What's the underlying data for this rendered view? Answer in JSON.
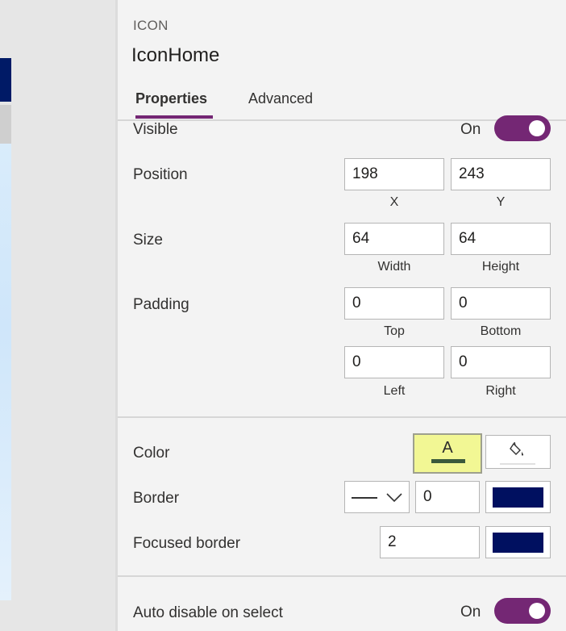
{
  "control": {
    "type": "ICON",
    "name": "IconHome"
  },
  "tabs": [
    {
      "label": "Properties",
      "active": true
    },
    {
      "label": "Advanced",
      "active": false
    }
  ],
  "visible": {
    "label": "Visible",
    "state": "On"
  },
  "position": {
    "label": "Position",
    "x": "198",
    "y": "243",
    "x_label": "X",
    "y_label": "Y"
  },
  "size": {
    "label": "Size",
    "width": "64",
    "height": "64",
    "width_label": "Width",
    "height_label": "Height"
  },
  "padding": {
    "label": "Padding",
    "top": "0",
    "bottom": "0",
    "left": "0",
    "right": "0",
    "top_label": "Top",
    "bottom_label": "Bottom",
    "left_label": "Left",
    "right_label": "Right"
  },
  "color": {
    "label": "Color",
    "letter": "A",
    "fill_color": "#f2f794",
    "underline_color": "#3b5a3b"
  },
  "border": {
    "label": "Border",
    "thickness": "0",
    "color": "#001060"
  },
  "focused_border": {
    "label": "Focused border",
    "thickness": "2",
    "color": "#001060"
  },
  "auto_disable": {
    "label": "Auto disable on select",
    "state": "On"
  },
  "theme": {
    "accent": "#742774"
  }
}
